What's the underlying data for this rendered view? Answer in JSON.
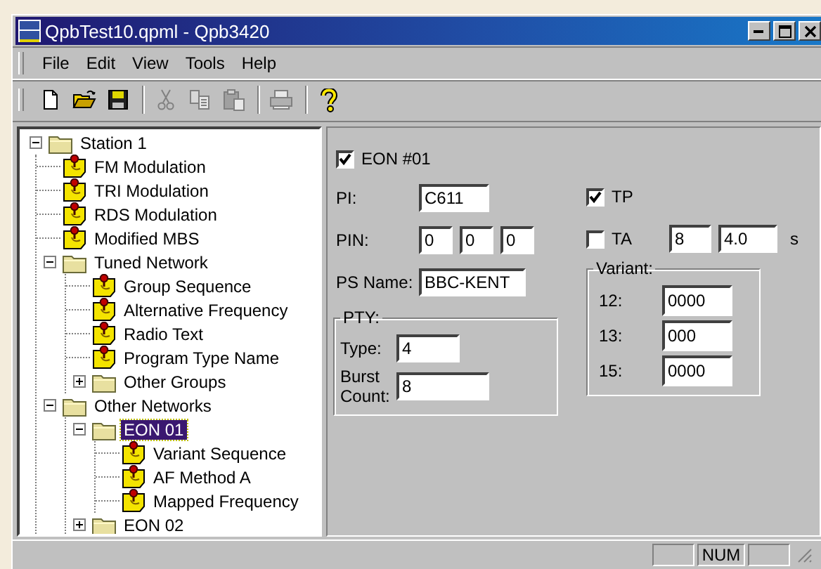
{
  "window": {
    "title": "QpbTest10.qpml - Qpb3420"
  },
  "menu": [
    "File",
    "Edit",
    "View",
    "Tools",
    "Help"
  ],
  "toolbar": [
    {
      "kind": "new",
      "disabled": false
    },
    {
      "kind": "open",
      "disabled": false
    },
    {
      "kind": "save",
      "disabled": false
    },
    {
      "kind": "separator"
    },
    {
      "kind": "cut",
      "disabled": true
    },
    {
      "kind": "copy",
      "disabled": true
    },
    {
      "kind": "paste",
      "disabled": true
    },
    {
      "kind": "separator"
    },
    {
      "kind": "print",
      "disabled": true
    },
    {
      "kind": "separator"
    },
    {
      "kind": "help",
      "disabled": false
    }
  ],
  "tree": [
    {
      "label": "Station 1",
      "kind": "folder",
      "expanded": true,
      "selected": false,
      "children": [
        {
          "label": "FM Modulation",
          "kind": "page",
          "selected": false
        },
        {
          "label": "TRI Modulation",
          "kind": "page",
          "selected": false
        },
        {
          "label": "RDS Modulation",
          "kind": "page",
          "selected": false
        },
        {
          "label": "Modified MBS",
          "kind": "page",
          "selected": false
        },
        {
          "label": "Tuned Network",
          "kind": "folder",
          "expanded": true,
          "selected": false,
          "children": [
            {
              "label": "Group Sequence",
              "kind": "page",
              "selected": false
            },
            {
              "label": "Alternative Frequency",
              "kind": "page",
              "selected": false
            },
            {
              "label": "Radio Text",
              "kind": "page",
              "selected": false
            },
            {
              "label": "Program Type Name",
              "kind": "page",
              "selected": false
            },
            {
              "label": "Other Groups",
              "kind": "folder",
              "expanded": false,
              "selected": false
            }
          ]
        },
        {
          "label": "Other Networks",
          "kind": "folder",
          "expanded": true,
          "selected": false,
          "children": [
            {
              "label": "EON 01",
              "kind": "folder",
              "expanded": true,
              "selected": true,
              "children": [
                {
                  "label": "Variant Sequence",
                  "kind": "page",
                  "selected": false
                },
                {
                  "label": "AF Method A",
                  "kind": "page",
                  "selected": false
                },
                {
                  "label": "Mapped Frequency",
                  "kind": "page",
                  "selected": false
                }
              ]
            },
            {
              "label": "EON 02",
              "kind": "folder",
              "expanded": false,
              "selected": false
            }
          ]
        }
      ]
    }
  ],
  "form": {
    "eon": {
      "label": "EON #01",
      "checked": true
    },
    "pi": {
      "label": "PI:",
      "value": "C611"
    },
    "pin": {
      "label": "PIN:",
      "values": [
        "0",
        "0",
        "0"
      ]
    },
    "ps_name": {
      "label": "PS Name:",
      "value": "BBC-KENT"
    },
    "pty": {
      "title": "PTY:",
      "type": {
        "label": "Type:",
        "value": "4"
      },
      "burst_count": {
        "label": "Burst Count:",
        "value": "8"
      }
    },
    "tp": {
      "label": "TP",
      "checked": true
    },
    "ta": {
      "label": "TA",
      "checked": false,
      "values": [
        "8",
        "4.0"
      ],
      "unit": "s"
    },
    "variant": {
      "title": "Variant:",
      "rows": [
        {
          "label": "12:",
          "value": "0000"
        },
        {
          "label": "13:",
          "value": "000"
        },
        {
          "label": "15:",
          "value": "0000"
        }
      ]
    }
  },
  "status_bar": {
    "num": "NUM"
  }
}
